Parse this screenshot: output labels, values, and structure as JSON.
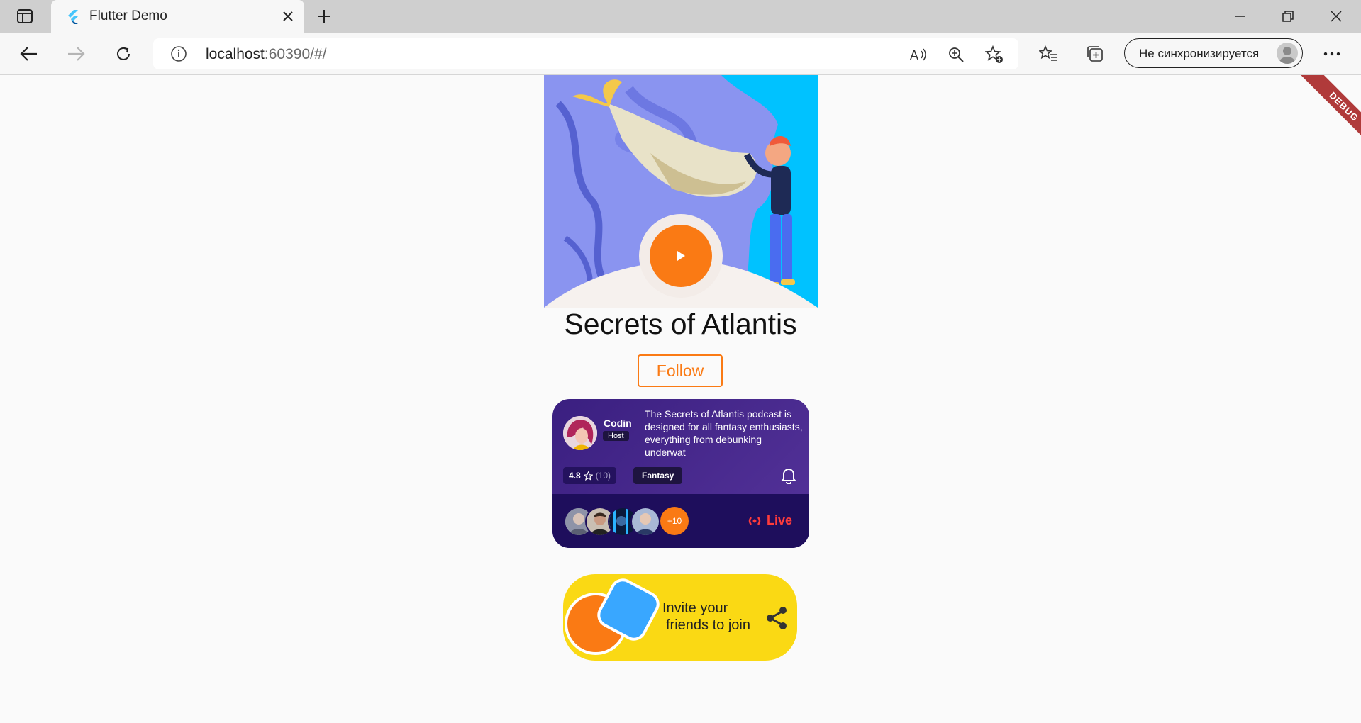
{
  "browser": {
    "tab_title": "Flutter Demo",
    "url_host": "localhost",
    "url_rest": ":60390/#/",
    "profile_label": "Не синхронизируется"
  },
  "debug_banner": "DEBUG",
  "podcast": {
    "title": "Secrets of Atlantis",
    "follow_label": "Follow",
    "host_name": "Codin",
    "host_role": "Host",
    "description": "The Secrets of Atlantis podcast is designed for all fantasy enthusiasts, everything from debunking underwat",
    "rating": "4.8",
    "rating_count": "(10)",
    "genre": "Fantasy",
    "listeners_more": "+10",
    "live_label": "Live"
  },
  "invite": {
    "line1": "Invite your",
    "line2": "friends to join"
  },
  "colors": {
    "accent_orange": "#fa7a14",
    "card_purple": "#3a1f80",
    "card_dark": "#1e0e5c",
    "invite_yellow": "#fad914",
    "invite_blue": "#39a7ff",
    "live_red": "#ff3b3b"
  }
}
